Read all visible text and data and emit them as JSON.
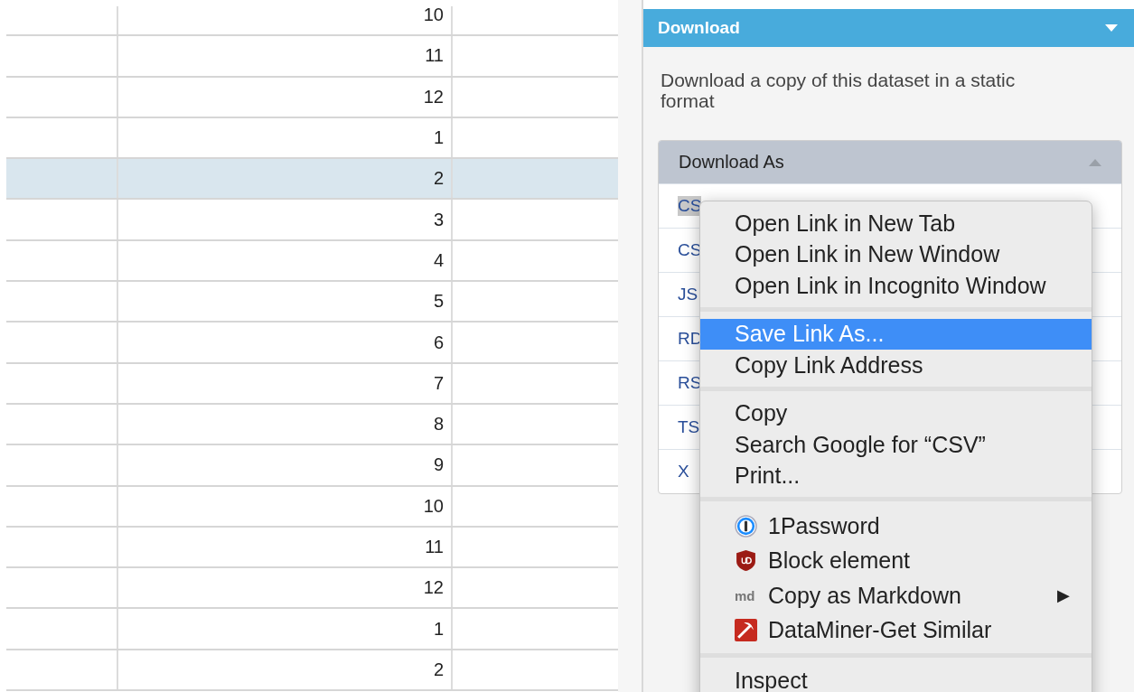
{
  "table": {
    "rows": [
      {
        "value": "10",
        "selected": false
      },
      {
        "value": "11",
        "selected": false
      },
      {
        "value": "12",
        "selected": false
      },
      {
        "value": "1",
        "selected": false
      },
      {
        "value": "2",
        "selected": true
      },
      {
        "value": "3",
        "selected": false
      },
      {
        "value": "4",
        "selected": false
      },
      {
        "value": "5",
        "selected": false
      },
      {
        "value": "6",
        "selected": false
      },
      {
        "value": "7",
        "selected": false
      },
      {
        "value": "8",
        "selected": false
      },
      {
        "value": "9",
        "selected": false
      },
      {
        "value": "10",
        "selected": false
      },
      {
        "value": "11",
        "selected": false
      },
      {
        "value": "12",
        "selected": false
      },
      {
        "value": "1",
        "selected": false
      },
      {
        "value": "2",
        "selected": false
      }
    ]
  },
  "download_panel": {
    "title": "Download",
    "expanded": true,
    "description": "Download a copy of this dataset in a static format",
    "download_as": {
      "title": "Download As",
      "expanded": true,
      "formats": [
        {
          "label": "CS",
          "selected": true
        },
        {
          "label": "CS",
          "selected": false
        },
        {
          "label": "JS",
          "selected": false
        },
        {
          "label": "RD",
          "selected": false
        },
        {
          "label": "RS",
          "selected": false
        },
        {
          "label": "TS",
          "selected": false
        },
        {
          "label": "X",
          "selected": false
        }
      ]
    }
  },
  "context_menu": {
    "groups": [
      [
        {
          "label": "Open Link in New Tab",
          "kind": "plain",
          "selected": false
        },
        {
          "label": "Open Link in New Window",
          "kind": "plain",
          "selected": false
        },
        {
          "label": "Open Link in Incognito Window",
          "kind": "plain",
          "selected": false
        }
      ],
      [
        {
          "label": "Save Link As...",
          "kind": "plain",
          "selected": true
        },
        {
          "label": "Copy Link Address",
          "kind": "plain",
          "selected": false
        }
      ],
      [
        {
          "label": "Copy",
          "kind": "plain",
          "selected": false
        },
        {
          "label": "Search Google for “CSV”",
          "kind": "plain",
          "selected": false
        },
        {
          "label": "Print...",
          "kind": "plain",
          "selected": false
        }
      ],
      [
        {
          "label": "1Password",
          "kind": "password",
          "selected": false
        },
        {
          "label": "Block element",
          "kind": "shield",
          "selected": false
        },
        {
          "label": "Copy as Markdown",
          "kind": "markdown",
          "badge": "md",
          "submenu_arrow": "▶",
          "selected": false
        },
        {
          "label": "DataMiner-Get Similar",
          "kind": "pickaxe",
          "selected": false
        }
      ],
      [
        {
          "label": "Inspect",
          "kind": "plain",
          "selected": false
        }
      ]
    ]
  }
}
